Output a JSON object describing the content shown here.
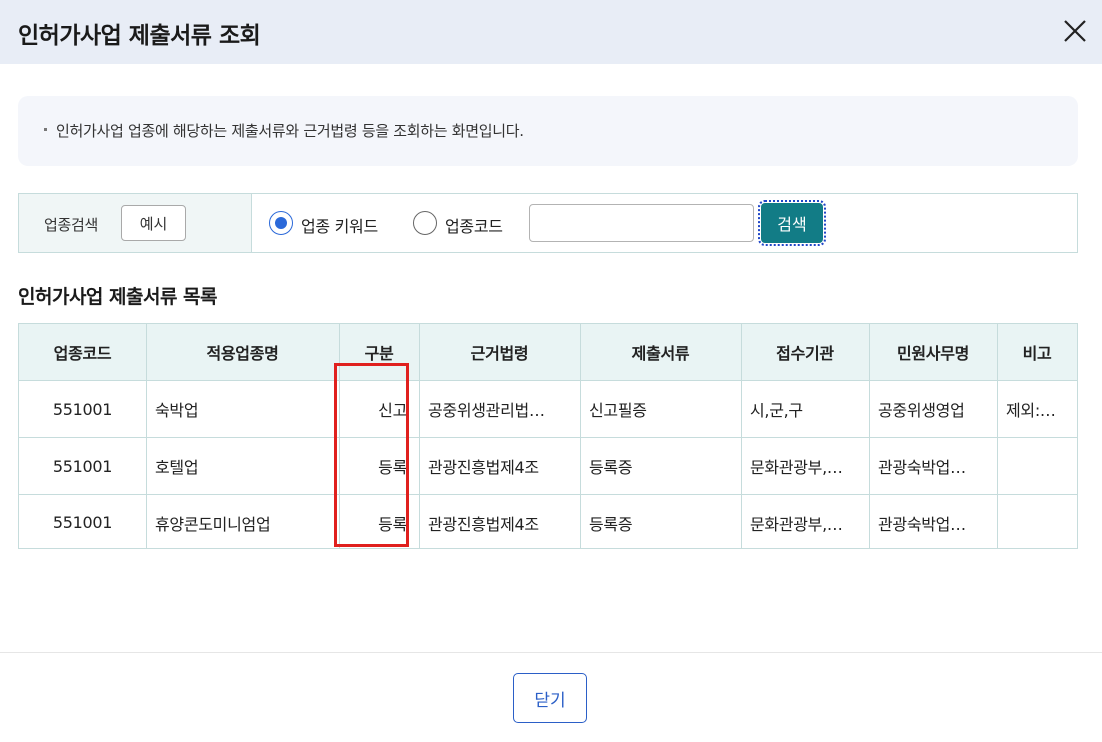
{
  "modal": {
    "title": "인허가사업 제출서류 조회",
    "close_icon": "close-icon"
  },
  "info": {
    "text": "인허가사업 업종에 해당하는 제출서류와 근거법령 등을 조회하는 화면입니다."
  },
  "search": {
    "label": "업종검색",
    "example_button": "예시",
    "radio_keyword_label": "업종 키워드",
    "radio_code_label": "업종코드",
    "selected_option": "업종 키워드",
    "input_value": "",
    "search_button": "검색"
  },
  "list": {
    "title": "인허가사업 제출서류 목록",
    "columns": [
      "업종코드",
      "적용업종명",
      "구분",
      "근거법령",
      "제출서류",
      "접수기관",
      "민원사무명",
      "비고"
    ],
    "rows": [
      [
        "551001",
        "숙박업",
        "신고",
        "공중위생관리법…",
        "신고필증",
        "시,군,구",
        "공중위생영업",
        "제외:…"
      ],
      [
        "551001",
        "호텔업",
        "등록",
        "관광진흥법제4조",
        "등록증",
        "문화관광부,…",
        "관광숙박업…",
        ""
      ],
      [
        "551001",
        "휴양콘도미니엄업",
        "등록",
        "관광진흥법제4조",
        "등록증",
        "문화관광부,…",
        "관광숙박업…",
        ""
      ]
    ]
  },
  "footer": {
    "close_button": "닫기"
  },
  "colors": {
    "header_bg": "#e8edf6",
    "search_button_bg": "#127c86",
    "highlight": "#e0201e",
    "accent_blue": "#2b69d9"
  }
}
